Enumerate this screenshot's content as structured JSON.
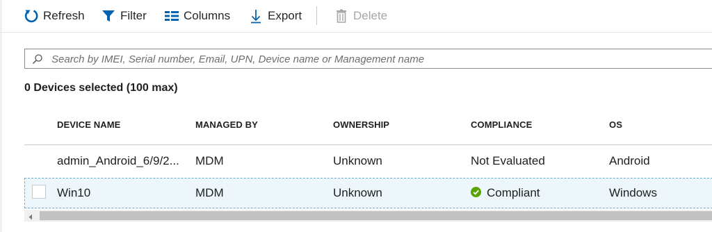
{
  "toolbar": {
    "refresh": {
      "label": "Refresh",
      "icon": "refresh-icon"
    },
    "filter": {
      "label": "Filter",
      "icon": "filter-icon"
    },
    "columns": {
      "label": "Columns",
      "icon": "columns-icon"
    },
    "export": {
      "label": "Export",
      "icon": "download-icon"
    },
    "delete": {
      "label": "Delete",
      "icon": "trash-icon",
      "disabled": true
    }
  },
  "search": {
    "placeholder": "Search by IMEI, Serial number, Email, UPN, Device name or Management name",
    "value": ""
  },
  "selection": {
    "label": "0 Devices selected (100 max)"
  },
  "table": {
    "columns": [
      "DEVICE NAME",
      "MANAGED BY",
      "OWNERSHIP",
      "COMPLIANCE",
      "OS"
    ],
    "rows": [
      {
        "device_name": "admin_Android_6/9/2...",
        "managed_by": "MDM",
        "ownership": "Unknown",
        "compliance": "Not Evaluated",
        "os": "Android"
      },
      {
        "device_name": "Win10",
        "managed_by": "MDM",
        "ownership": "Unknown",
        "compliance": "Compliant",
        "compliance_icon": "check-circle-icon",
        "os": "Windows"
      }
    ]
  },
  "colors": {
    "accent": "#0063b1",
    "success": "#57a300",
    "selected_row": "#edf6fb"
  }
}
